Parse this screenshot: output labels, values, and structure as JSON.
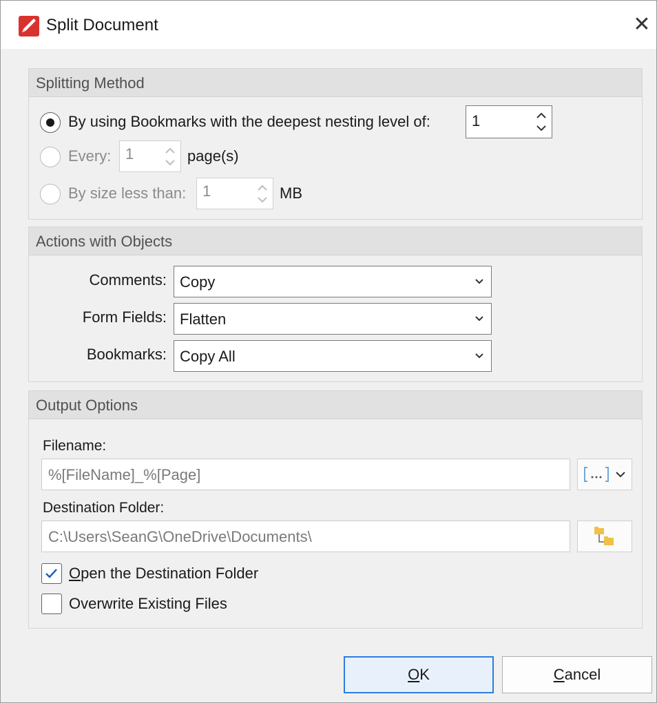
{
  "window": {
    "title": "Split Document",
    "close_label": "✕"
  },
  "splitting_method": {
    "title": "Splitting Method",
    "options": [
      {
        "label": "By using Bookmarks with the deepest nesting level of:",
        "value": "1",
        "selected": true,
        "enabled": true
      },
      {
        "label": "Every:",
        "value": "1",
        "suffix": "page(s)",
        "selected": false,
        "enabled": false
      },
      {
        "label": "By size less than:",
        "value": "1",
        "suffix": "MB",
        "selected": false,
        "enabled": false
      }
    ]
  },
  "actions_with_objects": {
    "title": "Actions with Objects",
    "rows": [
      {
        "label": "Comments:",
        "value": "Copy"
      },
      {
        "label": "Form Fields:",
        "value": "Flatten"
      },
      {
        "label": "Bookmarks:",
        "value": "Copy All"
      }
    ]
  },
  "output_options": {
    "title": "Output Options",
    "filename_label": "Filename:",
    "filename_value": "%[FileName]_%[Page]",
    "macro_button_label": "[···]",
    "destination_label": "Destination Folder:",
    "destination_value": "C:\\Users\\SeanG\\OneDrive\\Documents\\",
    "open_destination": {
      "label_prefix": "O",
      "label_rest": "pen the Destination Folder",
      "checked": true
    },
    "overwrite": {
      "label": "Overwrite Existing Files",
      "checked": false
    }
  },
  "buttons": {
    "ok_mnemonic": "O",
    "ok_rest": "K",
    "cancel_mnemonic": "C",
    "cancel_rest": "ancel"
  },
  "colors": {
    "accent": "#2b7de0",
    "app_icon": "#d8322e"
  }
}
